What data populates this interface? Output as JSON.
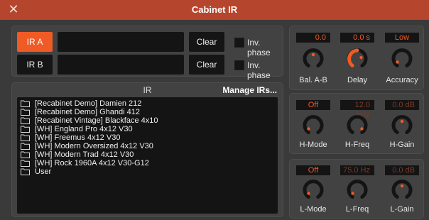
{
  "window": {
    "title": "Cabinet IR",
    "close_glyph": "✕"
  },
  "ir_a": {
    "label": "IR A",
    "path": "",
    "clear_label": "Clear",
    "inv_phase_label": "Inv. phase",
    "inv_phase_checked": false,
    "selected": true
  },
  "ir_b": {
    "label": "IR B",
    "path": "",
    "clear_label": "Clear",
    "inv_phase_label": "Inv. phase",
    "inv_phase_checked": false,
    "selected": false
  },
  "ir_list": {
    "header": "IR",
    "manage_label": "Manage IRs...",
    "items": [
      "[Recabinet Demo] Damien 212",
      "[Recabinet Demo] Ghandi 412",
      "[Recabinet Vintage] Blackface 4x10",
      "[WH] England Pro 4x12 V30",
      "[WH] Freemus 4x12 V30",
      "[WH] Modern Oversized 4x12 V30",
      "[WH] Modern Trad 4x12 V30",
      "[WH] Rock 1960A 4x12 V30-G12",
      "User"
    ]
  },
  "params": {
    "bal": {
      "label": "Bal. A-B",
      "value": "0.0",
      "color": "#f05a24"
    },
    "delay": {
      "label": "Delay",
      "value": "0.0 s",
      "color": "#f05a24"
    },
    "accuracy": {
      "label": "Accuracy",
      "value": "Low",
      "color": "#f05a24"
    },
    "h_mode": {
      "label": "H-Mode",
      "value": "Off",
      "color": "#f05a24"
    },
    "h_freq": {
      "label": "H-Freq",
      "value": "12.0 kHz",
      "color": "#7a3a28"
    },
    "h_gain": {
      "label": "H-Gain",
      "value": "0.0 dB",
      "color": "#7a3a28"
    },
    "l_mode": {
      "label": "L-Mode",
      "value": "Off",
      "color": "#f05a24"
    },
    "l_freq": {
      "label": "L-Freq",
      "value": "75.0 Hz",
      "color": "#7a3a28"
    },
    "l_gain": {
      "label": "L-Gain",
      "value": "0.0 dB",
      "color": "#7a3a28"
    }
  },
  "colors": {
    "accent": "#f05a24",
    "titlebar": "#b5452c",
    "panel": "#424242",
    "field": "#141414"
  }
}
